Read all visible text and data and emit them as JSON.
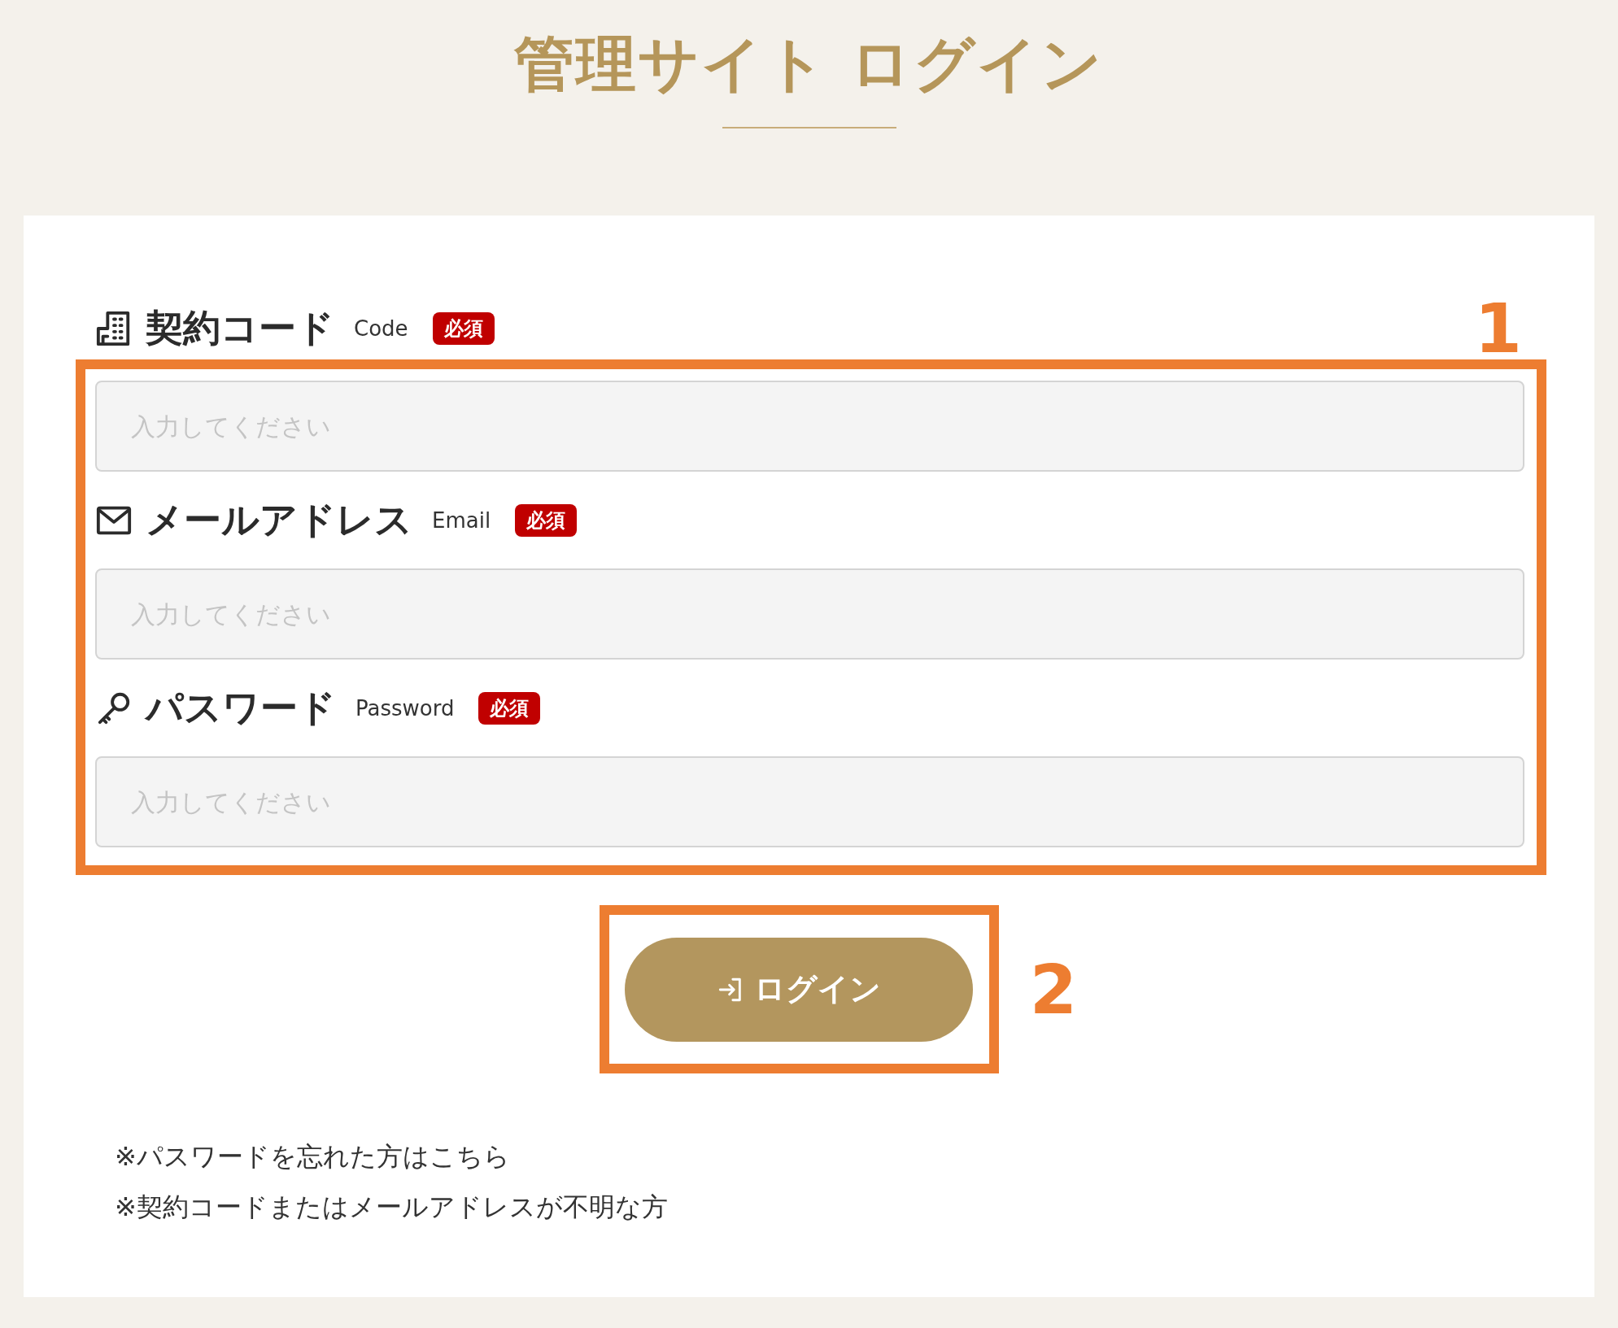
{
  "title": "管理サイト ログイン",
  "fields": [
    {
      "kind": "code",
      "label": "契約コード",
      "sublabel": "Code",
      "badge": "必須",
      "placeholder": "入力してください"
    },
    {
      "kind": "email",
      "label": "メールアドレス",
      "sublabel": "Email",
      "badge": "必須",
      "placeholder": "入力してください"
    },
    {
      "kind": "password",
      "label": "パスワード",
      "sublabel": "Password",
      "badge": "必須",
      "placeholder": "入力してください"
    }
  ],
  "login_button": {
    "label": "ログイン"
  },
  "notes": [
    "※パスワードを忘れた方はこちら",
    "※契約コードまたはメールアドレスが不明な方"
  ],
  "annotations": [
    "1",
    "2"
  ]
}
